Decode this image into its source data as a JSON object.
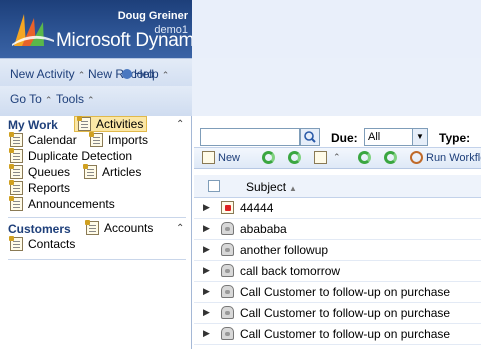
{
  "header": {
    "user_name": "Doug Greiner",
    "org_name": "demo1",
    "brand": "Microsoft Dynamics"
  },
  "menu": {
    "new_activity": "New Activity",
    "new_record": "New Record",
    "help": "Help",
    "go_to": "Go To",
    "tools": "Tools"
  },
  "nav": {
    "my_work_title": "My Work",
    "my_work_items": [
      "Activities",
      "Calendar",
      "Imports",
      "Duplicate Detection",
      "Queues",
      "Articles",
      "Reports",
      "Announcements"
    ],
    "customers_title": "Customers",
    "customers_items": [
      "Accounts",
      "Contacts"
    ]
  },
  "filters": {
    "search_value": "",
    "due_label": "Due:",
    "due_value": "All",
    "type_label": "Type:"
  },
  "toolbar": {
    "new_label": "New",
    "run_workflow_label": "Run Workflow"
  },
  "grid": {
    "column_subject": "Subject",
    "rows": [
      {
        "subject": "44444",
        "icon": "task-icon"
      },
      {
        "subject": "abababa",
        "icon": "phone-icon"
      },
      {
        "subject": "another followup",
        "icon": "phone-icon"
      },
      {
        "subject": "call back tomorrow",
        "icon": "phone-icon"
      },
      {
        "subject": "Call Customer to follow-up on purchase",
        "icon": "phone-icon"
      },
      {
        "subject": "Call Customer to follow-up on purchase",
        "icon": "phone-icon"
      },
      {
        "subject": "Call Customer to follow-up on purchase",
        "icon": "phone-icon"
      }
    ]
  },
  "colors": {
    "header_dark": "#1d3f7a",
    "link_blue": "#1e3f7a",
    "selected_bg": "#fbe7a6"
  }
}
